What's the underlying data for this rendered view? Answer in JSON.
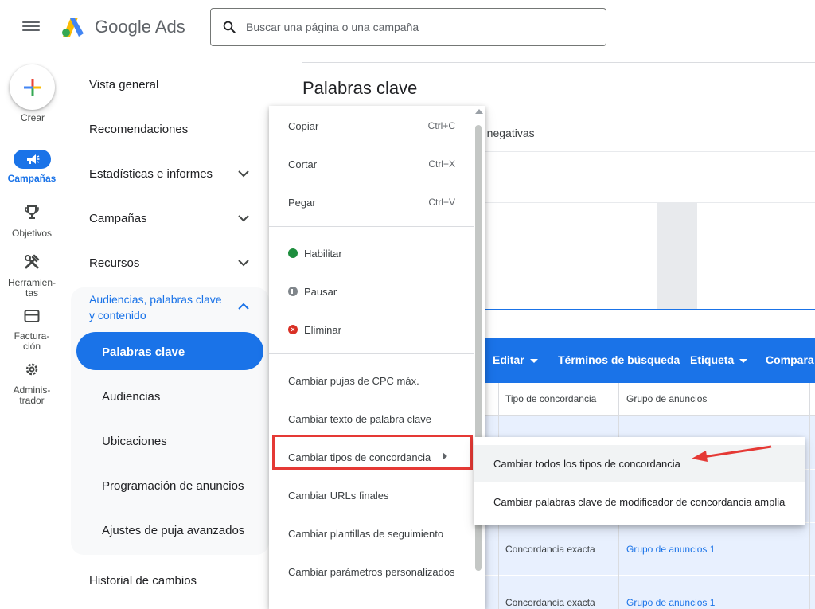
{
  "header": {
    "brand": "Google Ads",
    "search_placeholder": "Buscar una página o una campaña"
  },
  "rail": {
    "create_label": "Crear",
    "items": [
      {
        "label": "Campañas",
        "icon": "megaphone-icon"
      },
      {
        "label": "Objetivos",
        "icon": "trophy-icon"
      },
      {
        "label_line1": "Herramien-",
        "label_line2": "tas",
        "icon": "tools-icon"
      },
      {
        "label_line1": "Factura-",
        "label_line2": "ción",
        "icon": "credit-card-icon"
      },
      {
        "label_line1": "Adminis-",
        "label_line2": "trador",
        "icon": "gear-icon"
      }
    ]
  },
  "nav": {
    "overview": "Vista general",
    "recommendations": "Recomendaciones",
    "stats": "Estadísticas e informes",
    "campaigns": "Campañas",
    "resources": "Recursos",
    "audiences_line1": "Audiencias, palabras clave",
    "audiences_line2": "y contenido",
    "sub": [
      "Palabras clave",
      "Audiencias",
      "Ubicaciones",
      "Programación de anuncios",
      "Ajustes de puja avanzados"
    ],
    "history": "Historial de cambios"
  },
  "page": {
    "title": "Palabras clave",
    "tab_fragment": "e negativas"
  },
  "toolbar": {
    "edit": "Editar",
    "search_terms": "Términos de búsqueda",
    "label": "Etiqueta",
    "compare": "Compara"
  },
  "table": {
    "headers": [
      "Tipo de concordancia",
      "Grupo de anuncios"
    ],
    "rows": [
      {
        "match": "Concordancia exacta",
        "group": "Grupo de anuncios 1"
      },
      {
        "match": "Concordancia exacta",
        "group": "Grupo de anuncios 1"
      }
    ]
  },
  "menu": {
    "copy": "Copiar",
    "copy_sc": "Ctrl+C",
    "cut": "Cortar",
    "cut_sc": "Ctrl+X",
    "paste": "Pegar",
    "paste_sc": "Ctrl+V",
    "enable": "Habilitar",
    "pause": "Pausar",
    "remove": "Eliminar",
    "change_cpc": "Cambiar pujas de CPC máx.",
    "change_text": "Cambiar texto de palabra clave",
    "change_match": "Cambiar tipos de concordancia",
    "change_urls": "Cambiar URLs finales",
    "change_templates": "Cambiar plantillas de seguimiento",
    "change_params": "Cambiar parámetros personalizados"
  },
  "submenu": {
    "all_match": "Cambiar todos los tipos de concordancia",
    "broad_modifier": "Cambiar palabras clave de modificador de concordancia amplia"
  },
  "colors": {
    "primary": "#1a73e8",
    "highlight_box": "#e53935",
    "enabled": "#1e8e3e",
    "removed": "#d93025",
    "paused": "#5f6368"
  }
}
